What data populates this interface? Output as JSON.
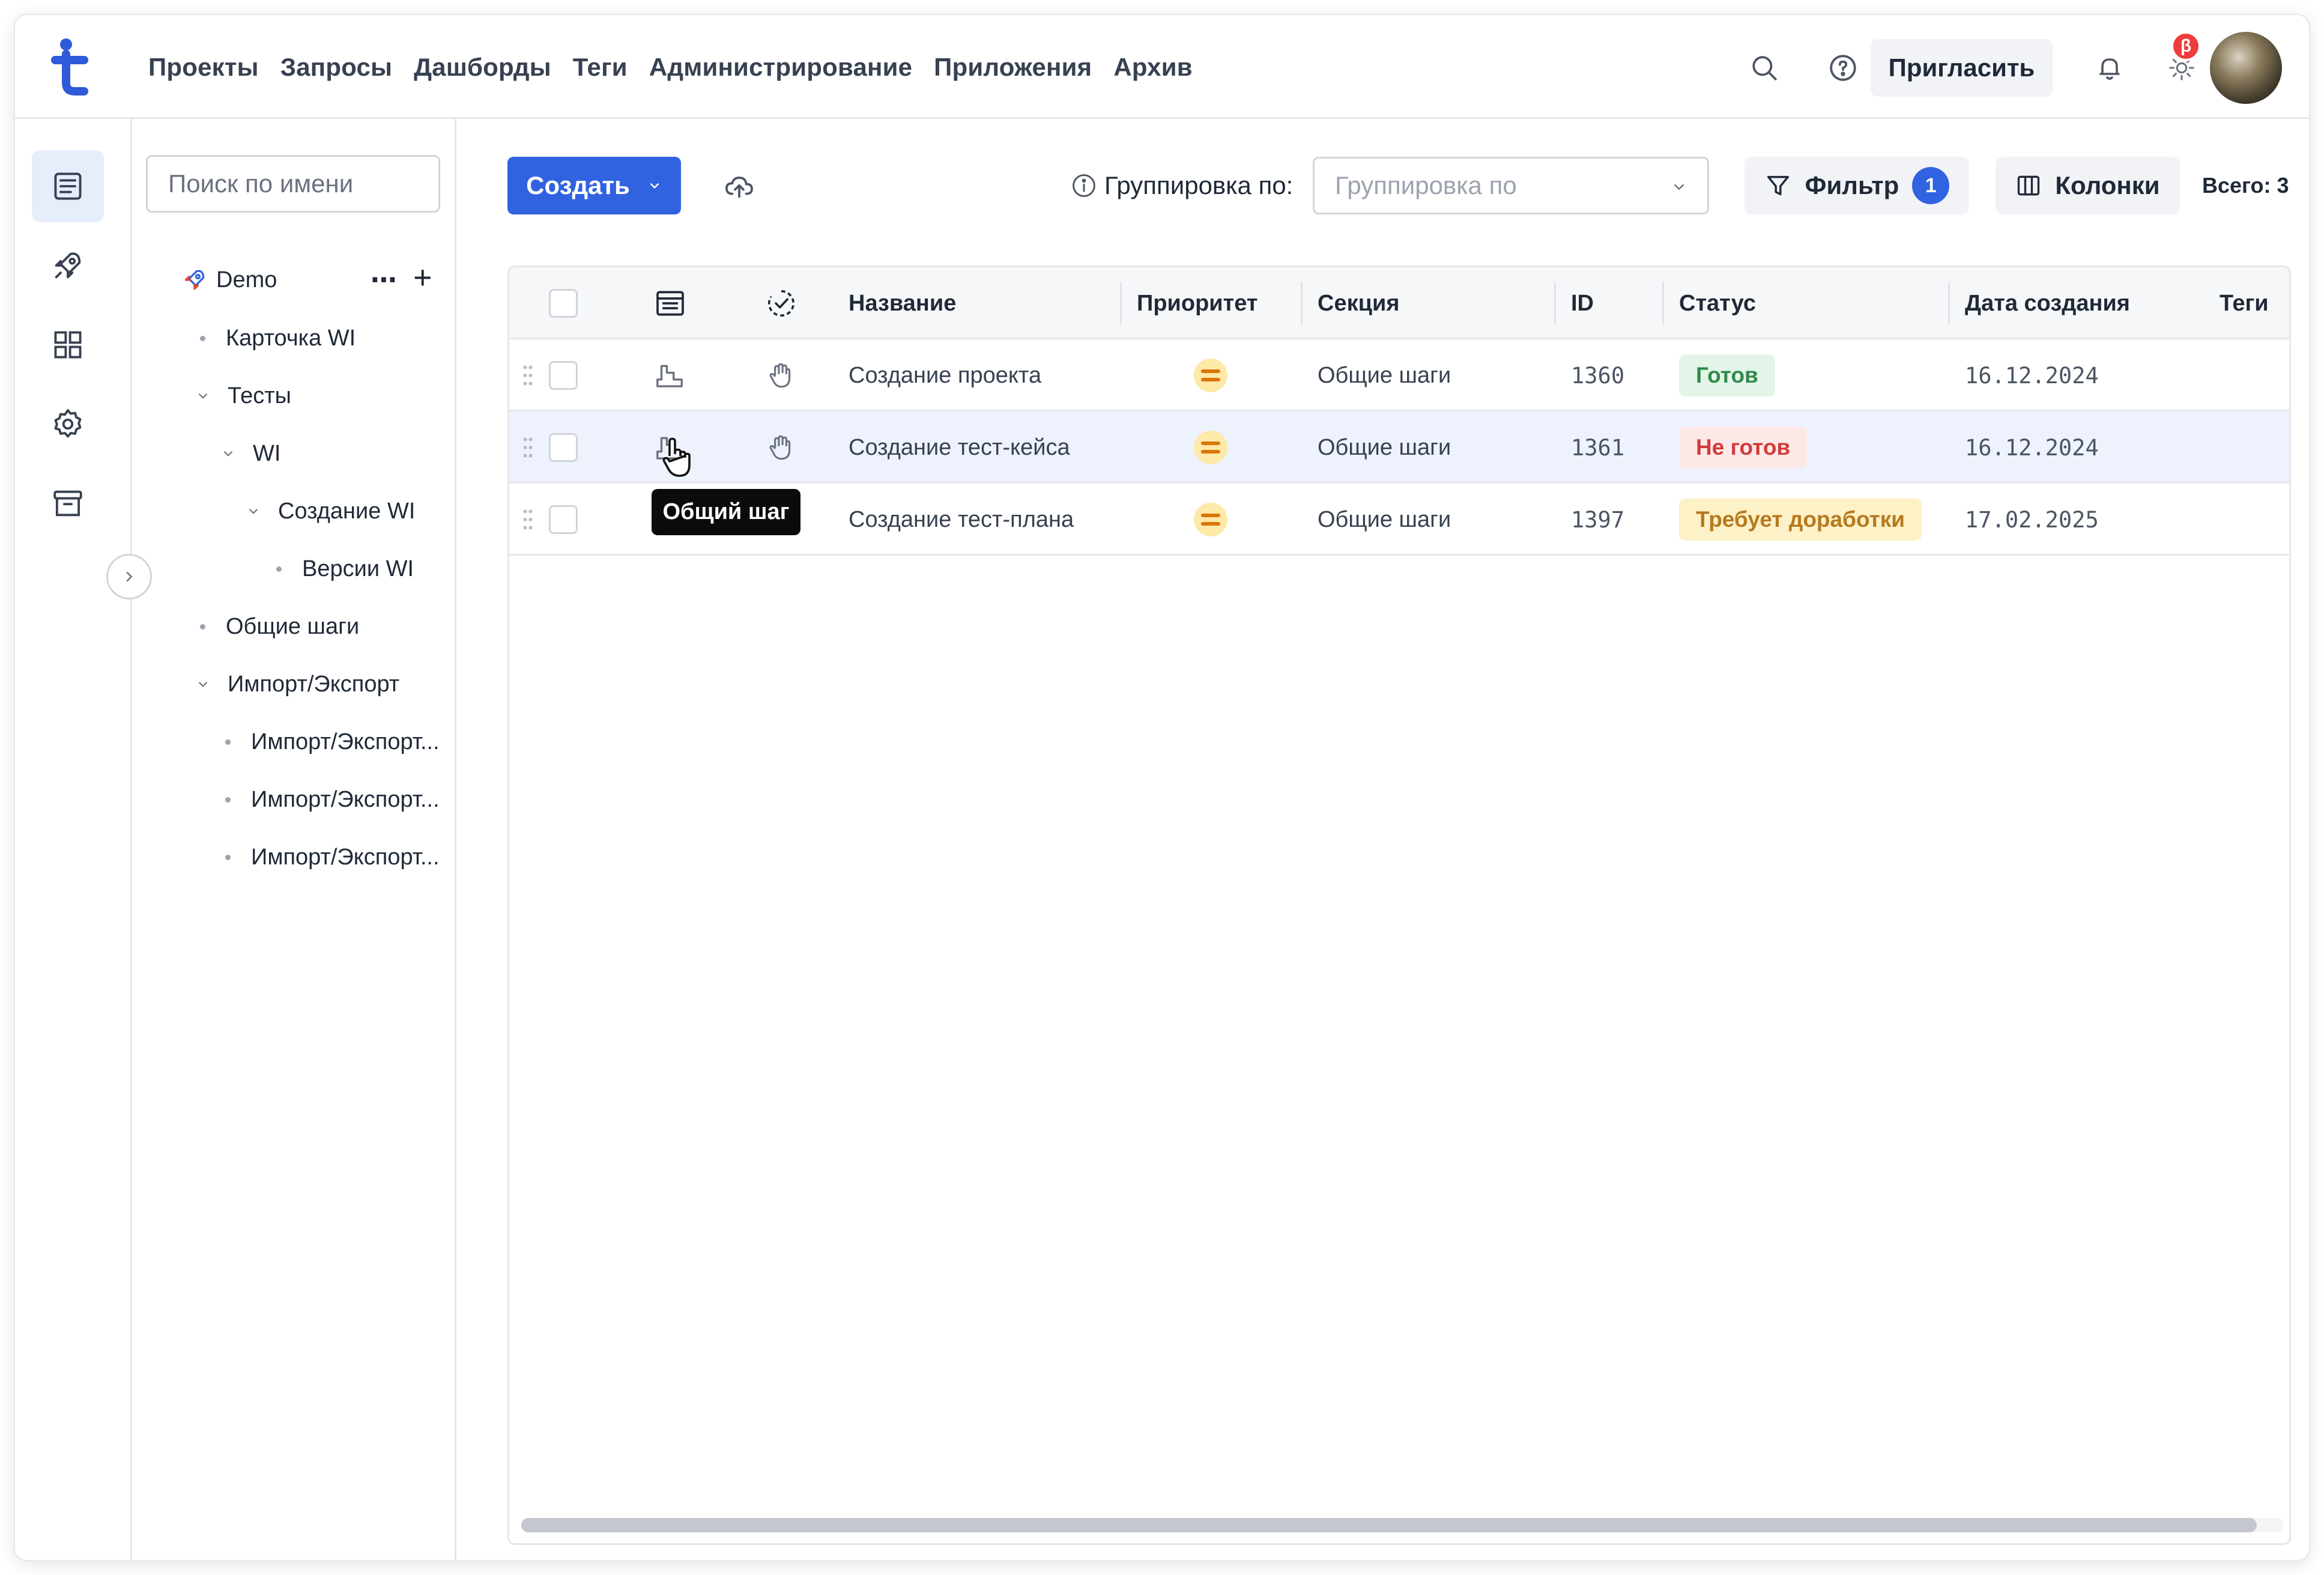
{
  "nav": {
    "items": [
      "Проекты",
      "Запросы",
      "Дашборды",
      "Теги",
      "Администрирование",
      "Приложения",
      "Архив"
    ],
    "invite_label": "Пригласить",
    "beta_badge": "β",
    "icons": [
      "search-icon",
      "help-icon",
      "bell-icon",
      "sun-icon"
    ]
  },
  "rail": {
    "items": [
      "list-icon",
      "rocket-icon",
      "dashboard-icon",
      "gear-icon",
      "archive-icon"
    ],
    "active": "list-icon"
  },
  "tree": {
    "search_placeholder": "Поиск по имени",
    "project": "Demo",
    "nodes": [
      {
        "label": "Карточка WI",
        "level": 1,
        "type": "leaf"
      },
      {
        "label": "Тесты",
        "level": 1,
        "type": "open"
      },
      {
        "label": "WI",
        "level": 2,
        "type": "open"
      },
      {
        "label": "Создание WI",
        "level": 3,
        "type": "open"
      },
      {
        "label": "Версии WI",
        "level": 4,
        "type": "leaf"
      },
      {
        "label": "Общие шаги",
        "level": 1,
        "type": "leaf"
      },
      {
        "label": "Импорт/Экспорт",
        "level": 1,
        "type": "open"
      },
      {
        "label": "Импорт/Экспорт...",
        "level": 2,
        "type": "leaf"
      },
      {
        "label": "Импорт/Экспорт...",
        "level": 2,
        "type": "leaf"
      },
      {
        "label": "Импорт/Экспорт...",
        "level": 2,
        "type": "leaf"
      }
    ]
  },
  "toolbar": {
    "create_label": "Создать",
    "group_label": "Группировка по:",
    "group_placeholder": "Группировка по",
    "filter_label": "Фильтр",
    "filter_count": "1",
    "columns_label": "Колонки",
    "total": "Всего: 3"
  },
  "table": {
    "columns": [
      "Название",
      "Приоритет",
      "Секция",
      "ID",
      "Статус",
      "Дата создания",
      "Теги"
    ],
    "rows": [
      {
        "name": "Создание проекта",
        "section": "Общие шаги",
        "id": "1360",
        "status": "Готов",
        "status_kind": "ready",
        "date": "16.12.2024"
      },
      {
        "name": "Создание тест-кейса",
        "section": "Общие шаги",
        "id": "1361",
        "status": "Не готов",
        "status_kind": "notready",
        "date": "16.12.2024"
      },
      {
        "name": "Создание тест-плана",
        "section": "Общие шаги",
        "id": "1397",
        "status": "Требует доработки",
        "status_kind": "rework",
        "date": "17.02.2025"
      }
    ],
    "hovered_row": 1
  },
  "tooltip": "Общий шаг",
  "colors": {
    "accent": "#3163e0",
    "ready": "#2f8a4a",
    "notready": "#d23b3b",
    "rework": "#b7791f",
    "priority": "#d97706"
  }
}
